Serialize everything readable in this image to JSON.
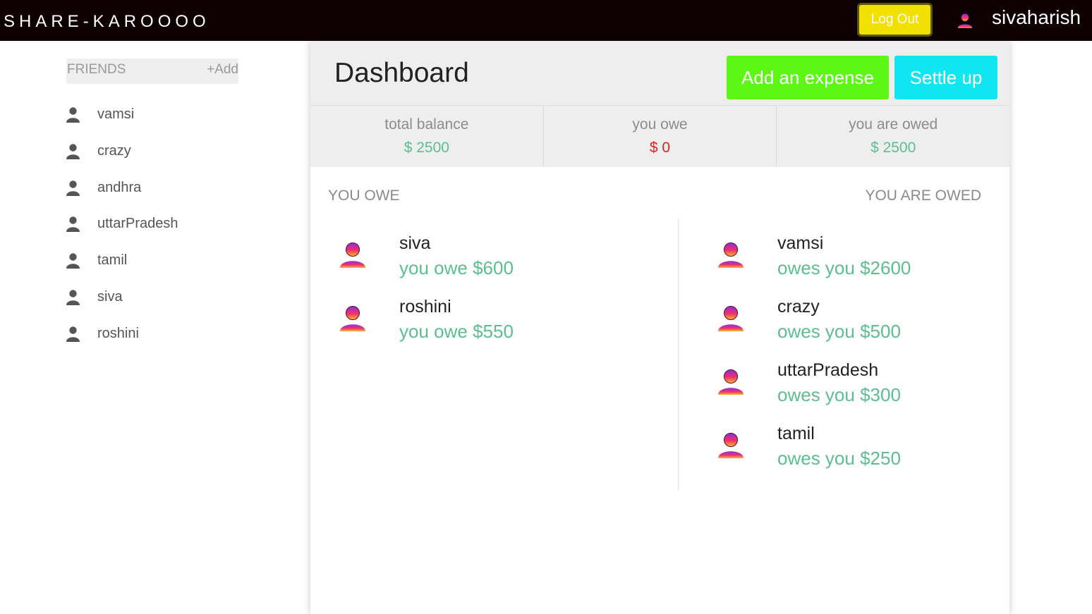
{
  "colors": {
    "positive": "#5bbf8f",
    "negative": "#e0241c",
    "navbar": "#0e0002",
    "expense_btn": "#5cf714",
    "settle_btn": "#0fe6f2",
    "logout_btn": "#f2e000"
  },
  "navbar": {
    "brand": "SHARE-KAROOOO",
    "logout_label": "Log Out",
    "avatar_icon": "user-gradient-icon",
    "username": "sivaharish"
  },
  "sidebar": {
    "header_label": "FRIENDS",
    "add_label": "+Add",
    "item_icon": "user-icon",
    "friends": [
      "vamsi",
      "crazy",
      "andhra",
      "uttarPradesh",
      "tamil",
      "siva",
      "roshini"
    ]
  },
  "dashboard": {
    "title": "Dashboard",
    "add_expense_label": "Add an expense",
    "settle_up_label": "Settle up",
    "summary": [
      {
        "label": "total balance",
        "value": "$ 2500",
        "tone": "positive"
      },
      {
        "label": "you owe",
        "value": "$ 0",
        "tone": "negative"
      },
      {
        "label": "you are owed",
        "value": "$ 2500",
        "tone": "positive"
      }
    ],
    "you_owe_heading": "YOU OWE",
    "you_are_owed_heading": "YOU ARE OWED",
    "you_owe": [
      {
        "name": "siva",
        "text": "you owe $600"
      },
      {
        "name": "roshini",
        "text": "you owe $550"
      }
    ],
    "owed_to_you": [
      {
        "name": "vamsi",
        "text": "owes you $2600"
      },
      {
        "name": "crazy",
        "text": "owes you $500"
      },
      {
        "name": "uttarPradesh",
        "text": "owes you $300"
      },
      {
        "name": "tamil",
        "text": "owes you $250"
      }
    ]
  }
}
